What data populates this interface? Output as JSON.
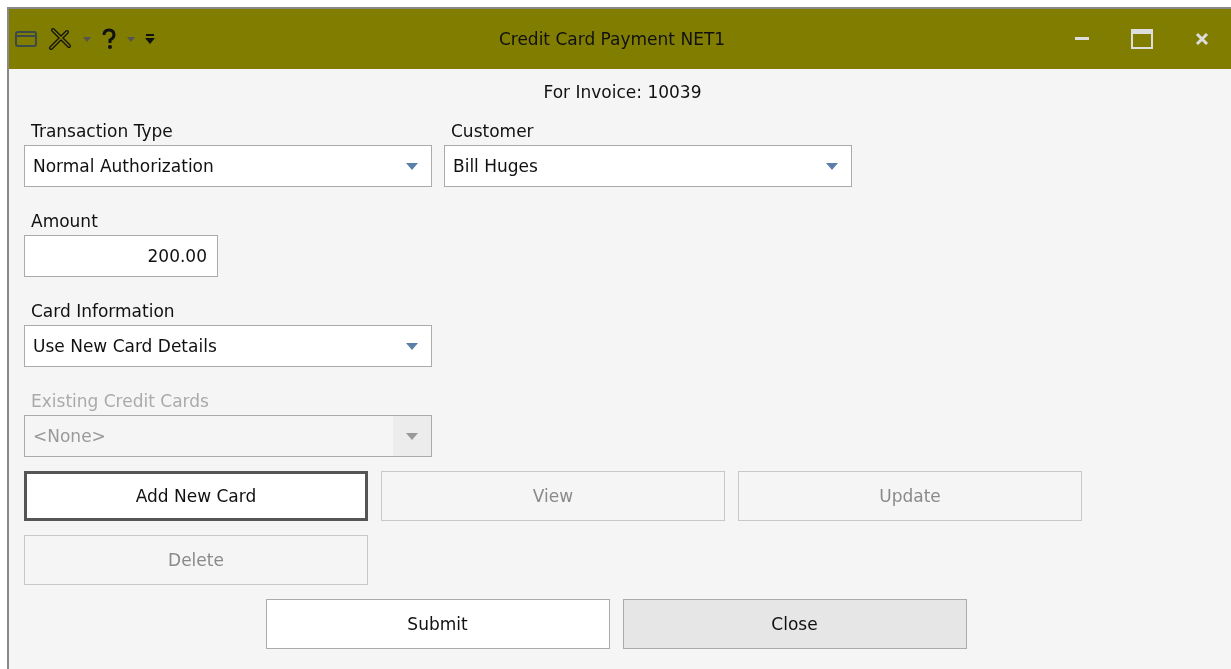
{
  "window": {
    "title": "Credit Card Payment NET1"
  },
  "invoice_label": "For Invoice: 10039",
  "fields": [
    {
      "kind": "combo",
      "label": "Transaction Type",
      "value": "Normal Authorization",
      "disabled": false
    },
    {
      "kind": "combo",
      "label": "Customer",
      "value": "Bill Huges",
      "disabled": false
    },
    {
      "kind": "number",
      "label": "Amount",
      "value": "200.00",
      "disabled": false
    },
    {
      "kind": "combo",
      "label": "Card Information",
      "value": "Use New Card Details",
      "disabled": false
    },
    {
      "kind": "combo",
      "label": "Existing Credit Cards",
      "value": "<None>",
      "disabled": true
    }
  ],
  "card_buttons": [
    {
      "label": "Add New Card",
      "disabled": false,
      "focused": true
    },
    {
      "label": "View",
      "disabled": true,
      "focused": false
    },
    {
      "label": "Update",
      "disabled": true,
      "focused": false
    },
    {
      "label": "Delete",
      "disabled": true,
      "focused": false
    }
  ],
  "footer_buttons": [
    {
      "label": "Submit",
      "highlighted": false
    },
    {
      "label": "Close",
      "highlighted": true
    }
  ]
}
